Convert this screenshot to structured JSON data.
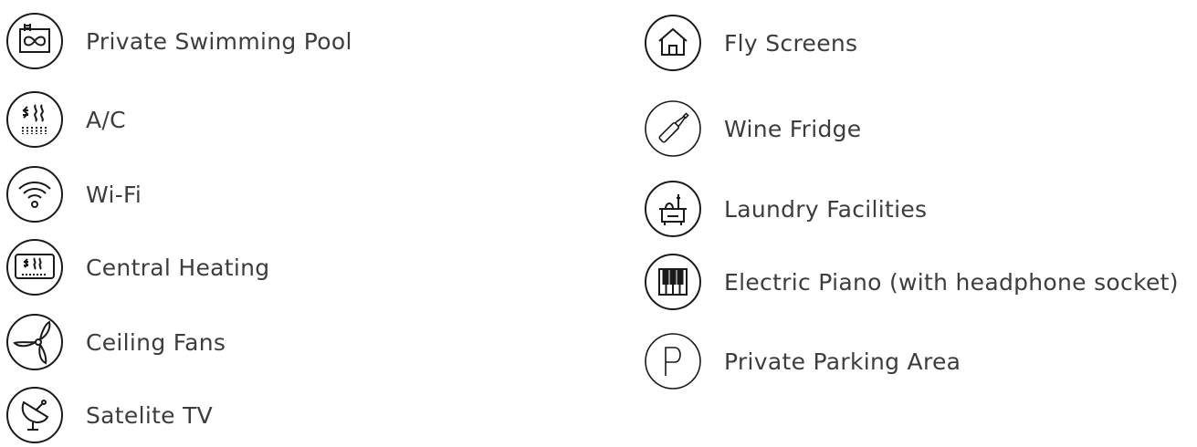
{
  "amenities": {
    "left": [
      {
        "icon": "swimming-pool-icon",
        "label": "Private Swimming Pool"
      },
      {
        "icon": "air-conditioning-icon",
        "label": "A/C"
      },
      {
        "icon": "wifi-icon",
        "label": "Wi-Fi"
      },
      {
        "icon": "central-heating-icon",
        "label": "Central Heating"
      },
      {
        "icon": "ceiling-fan-icon",
        "label": "Ceiling Fans"
      },
      {
        "icon": "satellite-dish-icon",
        "label": "Satelite TV"
      }
    ],
    "right": [
      {
        "icon": "house-icon",
        "label": "Fly Screens"
      },
      {
        "icon": "wine-bottle-icon",
        "label": "Wine Fridge"
      },
      {
        "icon": "laundry-icon",
        "label": "Laundry Facilities"
      },
      {
        "icon": "piano-keys-icon",
        "label": "Electric Piano (with headphone socket)"
      },
      {
        "icon": "parking-icon",
        "label": "Private Parking Area"
      }
    ]
  },
  "colors": {
    "text": "#3d3d3d",
    "icon_stroke": "#1a1a1a",
    "background": "#ffffff"
  }
}
